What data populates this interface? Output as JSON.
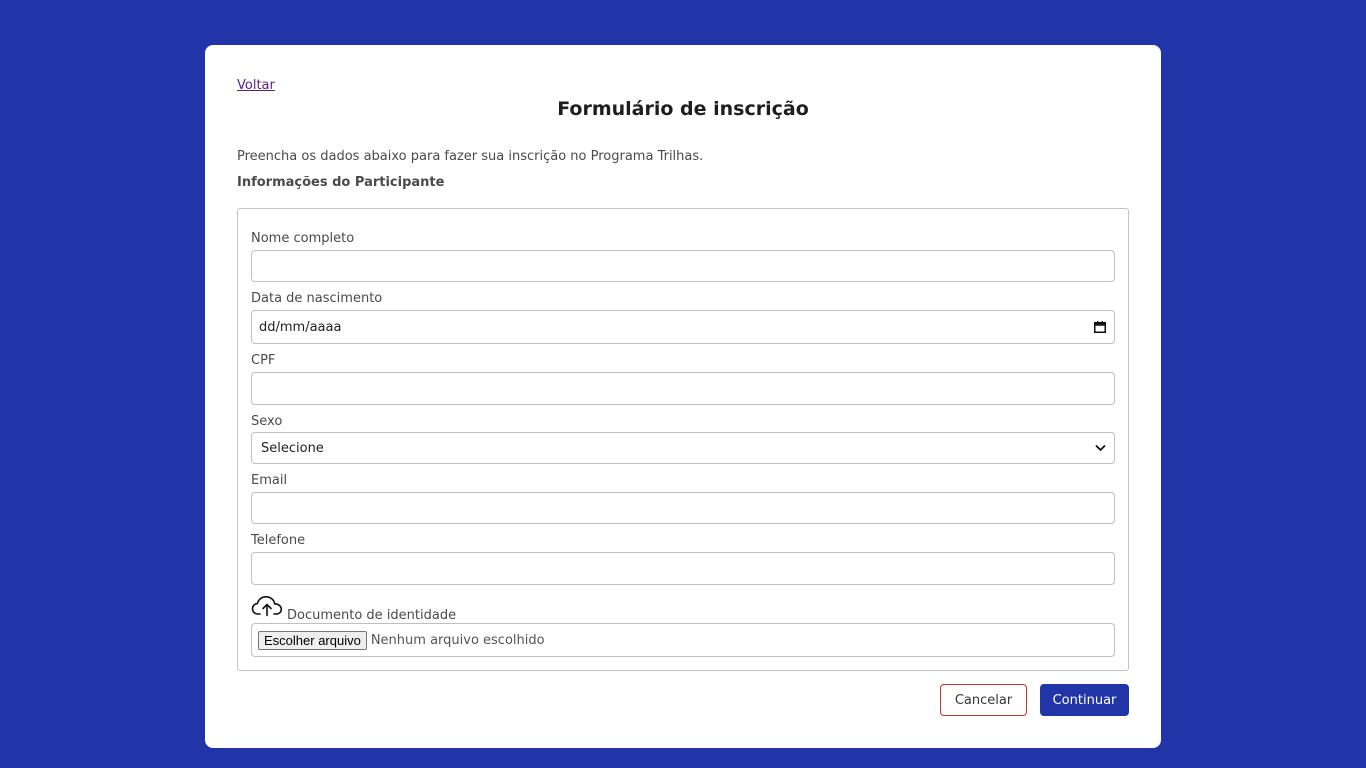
{
  "nav": {
    "back_label": "Voltar"
  },
  "page": {
    "title": "Formulário de inscrição",
    "intro": "Preencha os dados abaixo para fazer sua inscrição no Programa Trilhas.",
    "section_title": "Informações do Participante"
  },
  "form": {
    "name": {
      "label": "Nome completo",
      "value": ""
    },
    "birthdate": {
      "label": "Data de nascimento",
      "placeholder": "dd/mm/aaaa"
    },
    "cpf": {
      "label": "CPF",
      "value": ""
    },
    "sex": {
      "label": "Sexo",
      "selected": "Selecione"
    },
    "email": {
      "label": "Email",
      "value": ""
    },
    "phone": {
      "label": "Telefone",
      "value": ""
    },
    "document": {
      "label": "Documento de identidade",
      "button_label": "Escolher arquivo",
      "status": "Nenhum arquivo escolhido"
    }
  },
  "actions": {
    "cancel_label": "Cancelar",
    "continue_label": "Continuar"
  },
  "colors": {
    "background": "#2134a8",
    "primary": "#2134a8",
    "cancel_border": "#c0392b",
    "link": "#5a1f86"
  },
  "icons": {
    "calendar": "calendar-icon",
    "chevron": "chevron-down-icon",
    "upload": "cloud-upload-icon"
  }
}
